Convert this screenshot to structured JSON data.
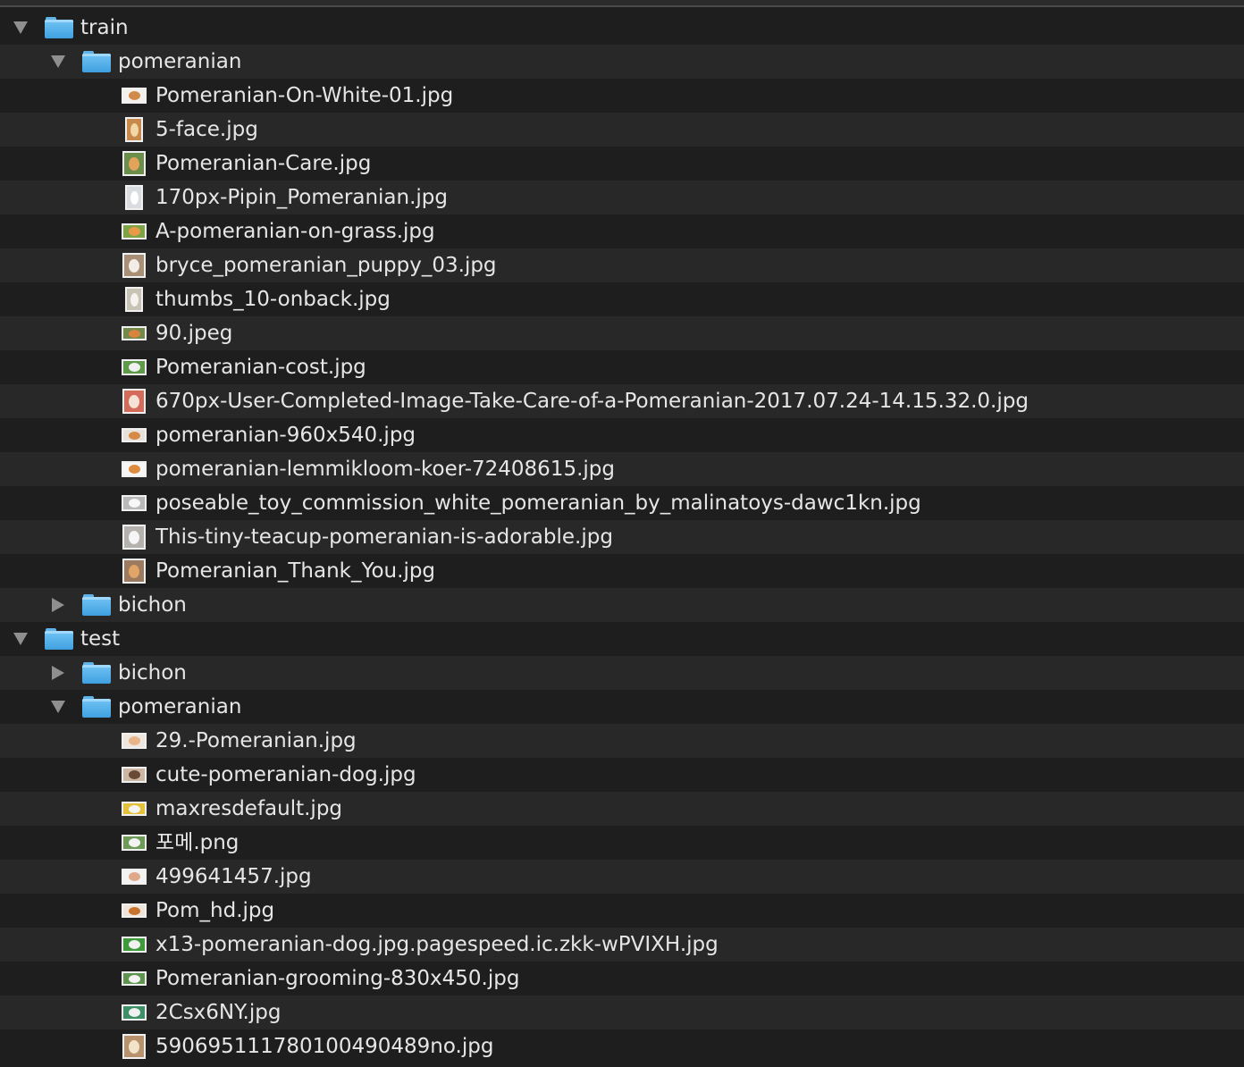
{
  "tree": {
    "rows": [
      {
        "kind": "folder",
        "level": 0,
        "expanded": true,
        "name": "train"
      },
      {
        "kind": "folder",
        "level": 1,
        "expanded": true,
        "name": "pomeranian"
      },
      {
        "kind": "file",
        "name": "Pomeranian-On-White-01.jpg",
        "thumb": "landscape",
        "bg": "#f4f1ec",
        "spot": "#d28a4a"
      },
      {
        "kind": "file",
        "name": "5-face.jpg",
        "thumb": "portrait",
        "bg": "#c88a4c",
        "spot": "#f2d7a8"
      },
      {
        "kind": "file",
        "name": "Pomeranian-Care.jpg",
        "thumb": "portrait-wide",
        "bg": "#6b8e4a",
        "spot": "#e3a35a"
      },
      {
        "kind": "file",
        "name": "170px-Pipin_Pomeranian.jpg",
        "thumb": "portrait",
        "bg": "#d9dde2",
        "spot": "#ffffff"
      },
      {
        "kind": "file",
        "name": "A-pomeranian-on-grass.jpg",
        "thumb": "landscape",
        "bg": "#7ca447",
        "spot": "#e89a48"
      },
      {
        "kind": "file",
        "name": "bryce_pomeranian_puppy_03.jpg",
        "thumb": "portrait-wide",
        "bg": "#a98f76",
        "spot": "#f2ede6"
      },
      {
        "kind": "file",
        "name": "thumbs_10-onback.jpg",
        "thumb": "portrait",
        "bg": "#c9c3b6",
        "spot": "#f5f3ef"
      },
      {
        "kind": "file",
        "name": "90.jpeg",
        "thumb": "landscape-thin",
        "bg": "#6f8a4b",
        "spot": "#d9843c"
      },
      {
        "kind": "file",
        "name": "Pomeranian-cost.jpg",
        "thumb": "landscape",
        "bg": "#5f9a4a",
        "spot": "#f0f0f0"
      },
      {
        "kind": "file",
        "name": "670px-User-Completed-Image-Take-Care-of-a-Pomeranian-2017.07.24-14.15.32.0.jpg",
        "thumb": "portrait-wide",
        "bg": "#d46a5a",
        "spot": "#f3e2d5"
      },
      {
        "kind": "file",
        "name": "pomeranian-960x540.jpg",
        "thumb": "landscape-thin",
        "bg": "#e9e2da",
        "spot": "#d78a45"
      },
      {
        "kind": "file",
        "name": "pomeranian-lemmikloom-koer-72408615.jpg",
        "thumb": "landscape",
        "bg": "#f6f6f6",
        "spot": "#de8b3d"
      },
      {
        "kind": "file",
        "name": "poseable_toy_commission_white_pomeranian_by_malinatoys-dawc1kn.jpg",
        "thumb": "landscape",
        "bg": "#b9b9b9",
        "spot": "#f7f7f7"
      },
      {
        "kind": "file",
        "name": "This-tiny-teacup-pomeranian-is-adorable.jpg",
        "thumb": "portrait-wide",
        "bg": "#b5b2ad",
        "spot": "#f5f5f5"
      },
      {
        "kind": "file",
        "name": "Pomeranian_Thank_You.jpg",
        "thumb": "portrait-wide",
        "bg": "#9b7a5f",
        "spot": "#e2a467"
      },
      {
        "kind": "folder",
        "level": 1,
        "expanded": false,
        "name": "bichon"
      },
      {
        "kind": "folder",
        "level": 0,
        "expanded": true,
        "name": "test"
      },
      {
        "kind": "folder",
        "level": 1,
        "expanded": false,
        "name": "bichon"
      },
      {
        "kind": "folder",
        "level": 1,
        "expanded": true,
        "name": "pomeranian"
      },
      {
        "kind": "file",
        "name": "29.-Pomeranian.jpg",
        "thumb": "landscape",
        "bg": "#efe6dd",
        "spot": "#e8b48a"
      },
      {
        "kind": "file",
        "name": "cute-pomeranian-dog.jpg",
        "thumb": "landscape",
        "bg": "#cbb7a3",
        "spot": "#6b4a35"
      },
      {
        "kind": "file",
        "name": "maxresdefault.jpg",
        "thumb": "landscape-thin",
        "bg": "#e3c13a",
        "spot": "#f4f4f4"
      },
      {
        "kind": "file",
        "name": "포메.png",
        "thumb": "landscape",
        "bg": "#6d9a56",
        "spot": "#f3f3f3"
      },
      {
        "kind": "file",
        "name": "499641457.jpg",
        "thumb": "landscape",
        "bg": "#f2f2f2",
        "spot": "#e0a88a"
      },
      {
        "kind": "file",
        "name": "Pom_hd.jpg",
        "thumb": "landscape-thin",
        "bg": "#efe4d8",
        "spot": "#c9732f"
      },
      {
        "kind": "file",
        "name": "x13-pomeranian-dog.jpg.pagespeed.ic.zkk-wPVIXH.jpg",
        "thumb": "landscape",
        "bg": "#3f9a3c",
        "spot": "#f1f1f1"
      },
      {
        "kind": "file",
        "name": "Pomeranian-grooming-830x450.jpg",
        "thumb": "landscape-thin",
        "bg": "#5d9450",
        "spot": "#f3f3f3"
      },
      {
        "kind": "file",
        "name": "2Csx6NY.jpg",
        "thumb": "landscape",
        "bg": "#3d8f66",
        "spot": "#f0f0f0"
      },
      {
        "kind": "file",
        "name": "590695111780100490489no.jpg",
        "thumb": "portrait-wide",
        "bg": "#b8926c",
        "spot": "#f1e3c9"
      }
    ]
  }
}
